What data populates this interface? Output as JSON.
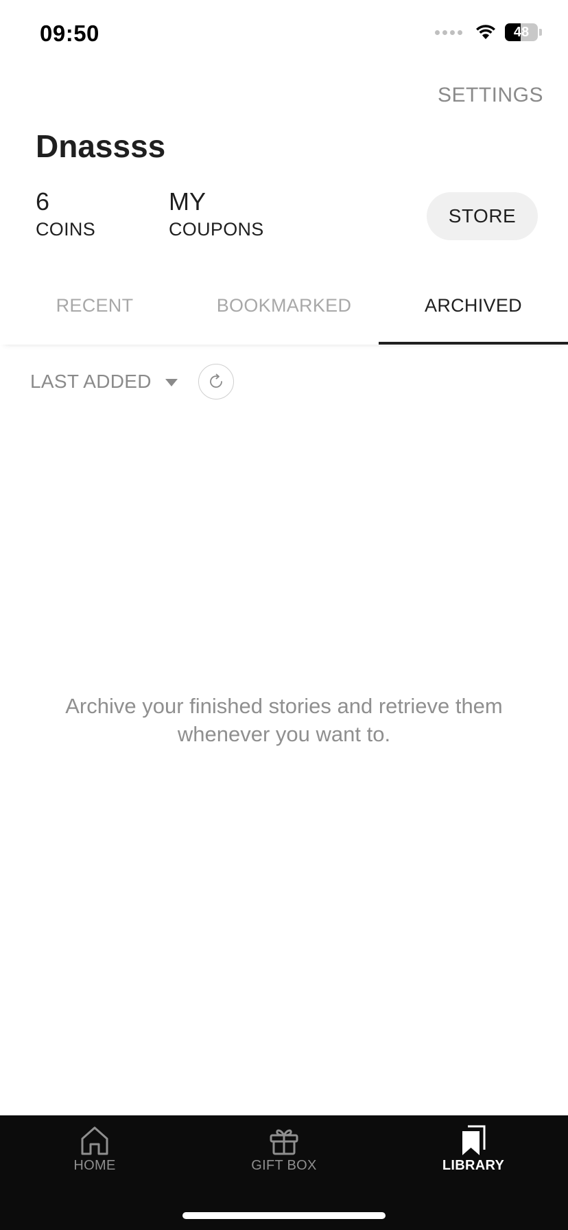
{
  "status_bar": {
    "time": "09:50",
    "battery": "48"
  },
  "header": {
    "settings_label": "SETTINGS",
    "username": "Dnassss"
  },
  "stats": {
    "coins_value": "6",
    "coins_label": "COINS",
    "coupons_value": "MY",
    "coupons_label": "COUPONS"
  },
  "store_label": "STORE",
  "tabs": [
    {
      "label": "RECENT",
      "active": false
    },
    {
      "label": "BOOKMARKED",
      "active": false
    },
    {
      "label": "ARCHIVED",
      "active": true
    }
  ],
  "sort": {
    "selected": "LAST ADDED"
  },
  "empty_state": {
    "message": "Archive your finished stories and retrieve them whenever you want to."
  },
  "bottom_nav": [
    {
      "label": "HOME",
      "icon": "home-icon",
      "active": false
    },
    {
      "label": "GIFT BOX",
      "icon": "gift-icon",
      "active": false
    },
    {
      "label": "LIBRARY",
      "icon": "bookmark-icon",
      "active": true
    }
  ],
  "colors": {
    "accent": "#1f1f1f",
    "muted": "#8a8a8a",
    "nav_bg": "#0c0c0c"
  }
}
